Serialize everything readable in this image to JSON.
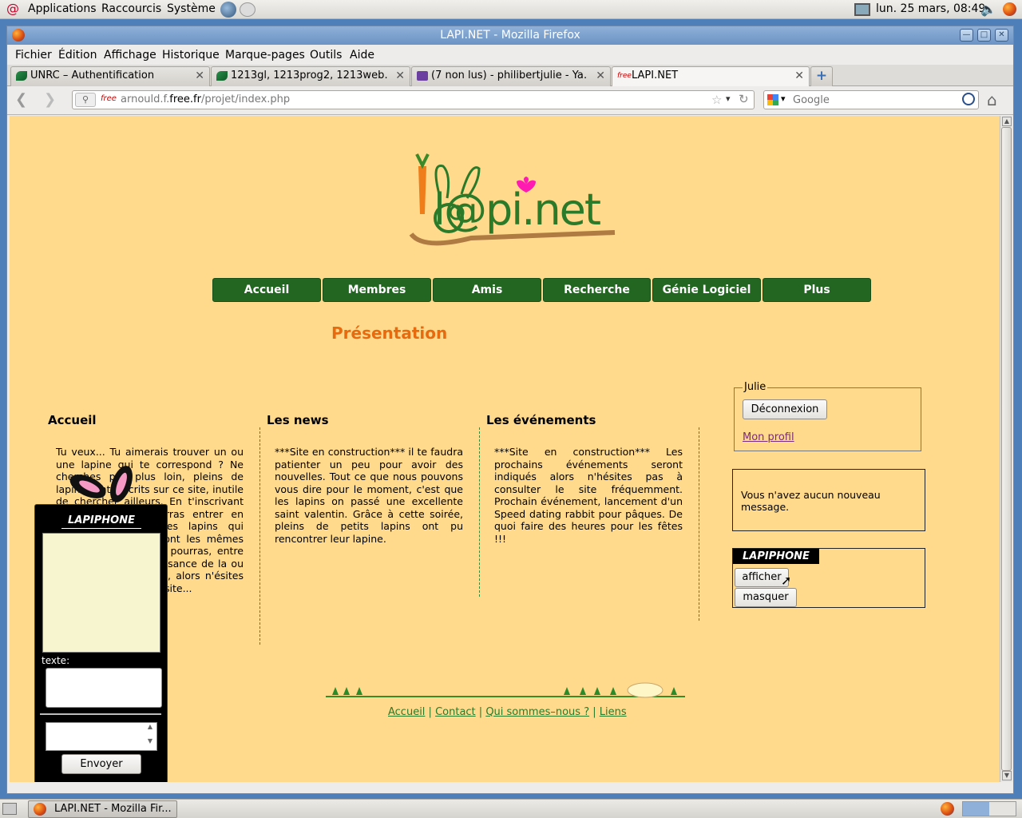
{
  "top_panel": {
    "menus": [
      "Applications",
      "Raccourcis",
      "Système"
    ],
    "clock": "lun. 25 mars, 08:49"
  },
  "window": {
    "title": "LAPI.NET - Mozilla Firefox",
    "menu": [
      "Fichier",
      "Édition",
      "Affichage",
      "Historique",
      "Marque-pages",
      "Outils",
      "Aide"
    ],
    "tabs": [
      {
        "label": "UNRC – Authentification",
        "active": false
      },
      {
        "label": "1213gl, 1213prog2, 1213web…",
        "active": false
      },
      {
        "label": "(7 non lus) - philibertjulie - Ya…",
        "active": false
      },
      {
        "label": "LAPI.NET",
        "active": true
      }
    ],
    "url": {
      "prefix": "arnould.f.",
      "domain": "free.fr",
      "path": "/projet/index.php"
    },
    "search_placeholder": "Google"
  },
  "page": {
    "logo_text": "l@pi.net",
    "nav": [
      "Accueil",
      "Membres",
      "Amis",
      "Recherche",
      "Génie Logiciel",
      "Plus"
    ],
    "heading": "Présentation",
    "columns": [
      {
        "title": "Accueil",
        "text": "Tu veux... Tu aimerais trouver un ou une lapine qui te correspond ? Ne cherches pas plus loin, pleins de lapins sont inscrits sur ce site, inutile de chercher ailleurs. En t'inscrivant sur ce site, tu pourras entrer en contact avec d'autres lapins qui partagent peut-être ont les mêmes centres d'intérêts. Tu pourras, entre autre, faire la connaissance de la ou du lapin de tes rêves, alors n'ésites pas, inscris toi sur ce site..."
      },
      {
        "title": "Les news",
        "text": "***Site en construction*** il te faudra patienter un peu pour avoir des nouvelles. Tout ce que nous pouvons vous dire pour le moment, c'est que les lapins on passé une excellente saint valentin. Grâce à cette soirée, pleins de petits lapins ont pu rencontrer leur lapine."
      },
      {
        "title": "Les événements",
        "text": "***Site en construction*** Les prochains événements seront indiqués alors n'hésites pas à consulter le site fréquemment. Prochain événement, lancement d'un Speed dating rabbit pour pâques. De quoi faire des heures pour les fêtes !!!"
      }
    ],
    "user_box": {
      "legend": "Julie",
      "logout": "Déconnexion",
      "profile": "Mon profil"
    },
    "messages": "Vous n'avez aucun nouveau message.",
    "lapiphone_widget": {
      "title": "LAPIPHONE",
      "show": "afficher",
      "hide": "masquer"
    },
    "footer_links": [
      "Accueil",
      "Contact",
      "Qui sommes–nous ?",
      "Liens"
    ],
    "lapiphone_popup": {
      "title": "LAPIPHONE",
      "text_label": "texte:",
      "send": "Envoyer"
    }
  },
  "taskbar": {
    "window_label": "LAPI.NET - Mozilla Fir..."
  },
  "colors": {
    "page_bg": "#ffda8d",
    "nav_green": "#226622",
    "heading_orange": "#e86a0f",
    "link_green": "#2a7a2a"
  }
}
